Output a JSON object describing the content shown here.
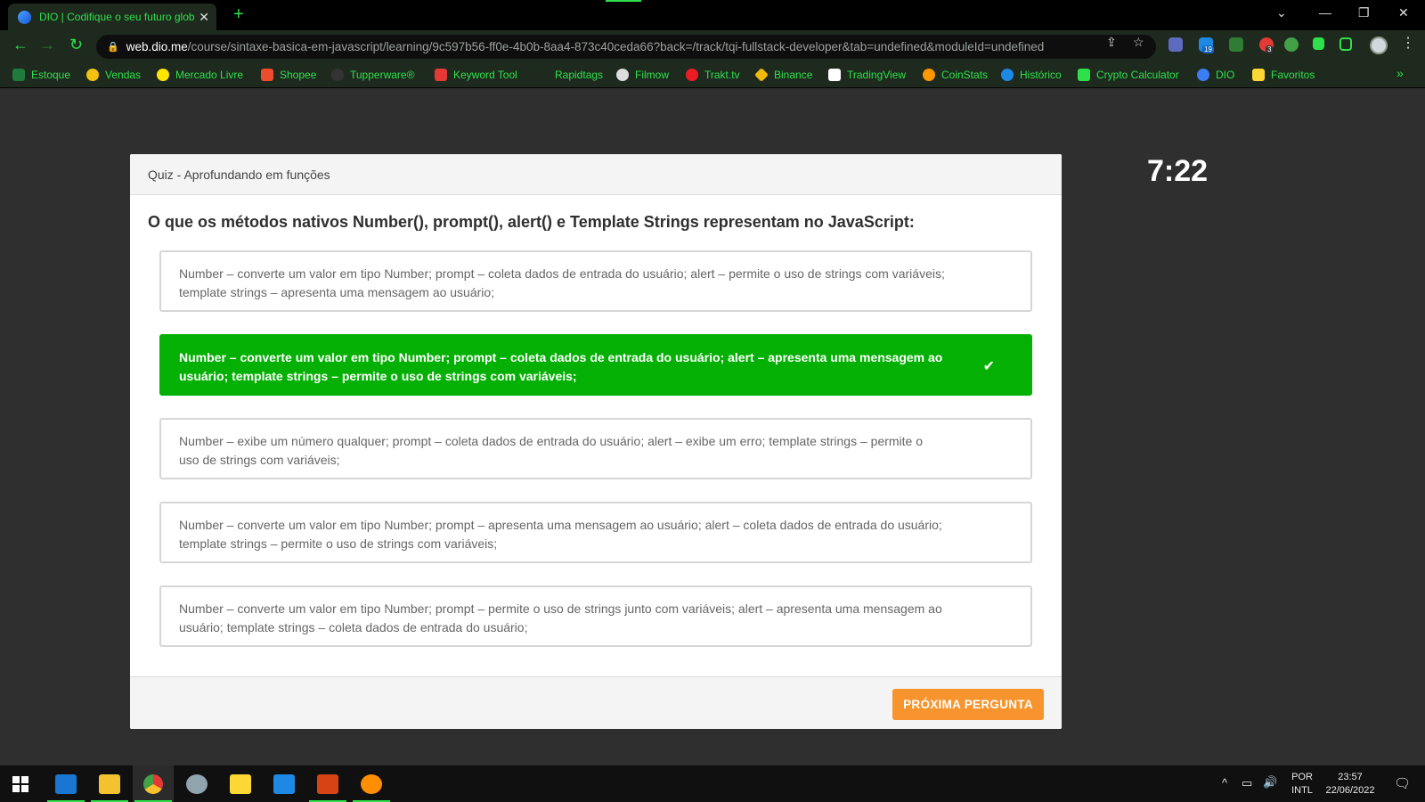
{
  "browser": {
    "tab_title": "DIO | Codifique o seu futuro glob",
    "tab_close": "✕",
    "new_tab": "+",
    "url_host": "web.dio.me",
    "url_path": "/course/sintaxe-basica-em-javascript/learning/9c597b56-ff0e-4b0b-8aa4-873c40ceda66?back=/track/tqi-fullstack-developer&tab=undefined&moduleId=undefined",
    "badge_tab_count": "19",
    "badge_notif": "3",
    "bookmarks": [
      {
        "label": "Estoque",
        "color": "#1e7b3c"
      },
      {
        "label": "Vendas",
        "color": "#f4c20d"
      },
      {
        "label": "Mercado Livre",
        "color": "#ffe600"
      },
      {
        "label": "Shopee",
        "color": "#ee4d2d"
      },
      {
        "label": "Tupperware®",
        "color": "#333333"
      },
      {
        "label": "Keyword Tool",
        "color": "#e53935"
      },
      {
        "label": "Rapidtags",
        "color": "#1f2a1f"
      },
      {
        "label": "Filmow",
        "color": "#dddddd"
      },
      {
        "label": "Trakt.tv",
        "color": "#ed1c24"
      },
      {
        "label": "Binance",
        "color": "#f0b90b"
      },
      {
        "label": "TradingView",
        "color": "#ffffff"
      },
      {
        "label": "CoinStats",
        "color": "#ff9800"
      },
      {
        "label": "Histórico",
        "color": "#1e88e5"
      },
      {
        "label": "Crypto Calculator",
        "color": "#2ee04a"
      },
      {
        "label": "DIO",
        "color": "#3b7df5"
      },
      {
        "label": "Favoritos",
        "color": "#fdd835"
      }
    ],
    "bookmarks_more": "»"
  },
  "quiz": {
    "title": "Quiz - Aprofundando em funções",
    "question": "O que os métodos nativos Number(), prompt(), alert() e Template Strings  representam no JavaScript:",
    "options": [
      {
        "text": "Number – converte um valor em tipo Number; prompt – coleta dados de entrada do usuário; alert – permite o uso de strings com variáveis; template strings – apresenta uma mensagem ao usuário;",
        "selected": false
      },
      {
        "text": "Number – converte um valor em tipo Number; prompt – coleta dados de entrada do usuário; alert – apresenta uma mensagem ao usuário; template strings – permite o uso de strings com variáveis;",
        "selected": true
      },
      {
        "text": "Number – exibe um número qualquer; prompt – coleta dados de entrada do usuário; alert – exibe um erro; template strings – permite o uso de strings com variáveis;",
        "selected": false
      },
      {
        "text": "Number – converte um valor em tipo Number; prompt – apresenta uma mensagem ao usuário; alert – coleta dados de entrada do usuário; template strings – permite o uso de strings com variáveis;",
        "selected": false
      },
      {
        "text": "Number – converte um valor em tipo Number; prompt – permite o uso de strings junto com variáveis; alert – apresenta uma mensagem ao usuário; template strings – coleta dados de entrada do usuário;",
        "selected": false
      }
    ],
    "next_button": "PRÓXIMA PERGUNTA",
    "timer": "7:22"
  },
  "taskbar": {
    "lang_top": "POR",
    "lang_bottom": "INTL",
    "time": "23:57",
    "date": "22/06/2022"
  },
  "colors": {
    "accent_green": "#2ee04a",
    "correct": "#05b005",
    "button": "#f7942e"
  }
}
